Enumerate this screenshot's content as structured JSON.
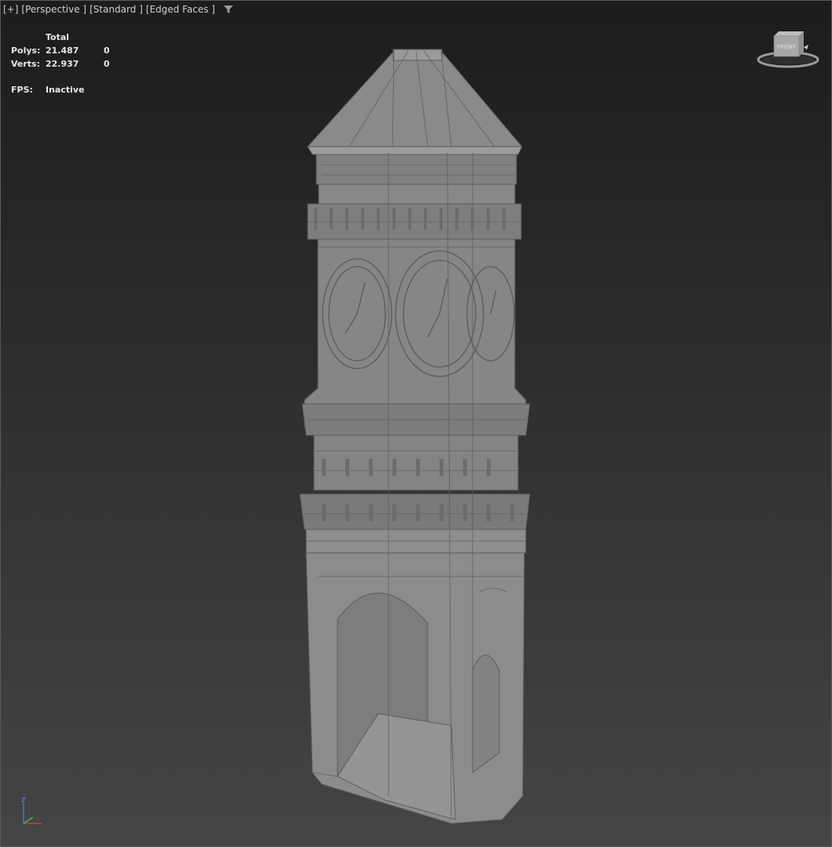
{
  "viewport": {
    "labels": {
      "plus": "[+]",
      "view": "[Perspective ]",
      "shading": "[Standard ]",
      "mode": "[Edged Faces ]"
    },
    "filter_icon": "filter-icon"
  },
  "stats": {
    "header": "Total",
    "polys_label": "Polys:",
    "polys_total": "21.487",
    "polys_selected": "0",
    "verts_label": "Verts:",
    "verts_total": "22.937",
    "verts_selected": "0",
    "fps_label": "FPS:",
    "fps_value": "Inactive"
  },
  "viewcube": {
    "face_label": "FRONT"
  },
  "axis_tripod": {
    "z_label": "Z"
  },
  "colors": {
    "model_fill": "#8a8a8a",
    "model_edges": "#5c5c5c",
    "background_top": "#1c1c1c",
    "background_bottom": "#454545"
  }
}
